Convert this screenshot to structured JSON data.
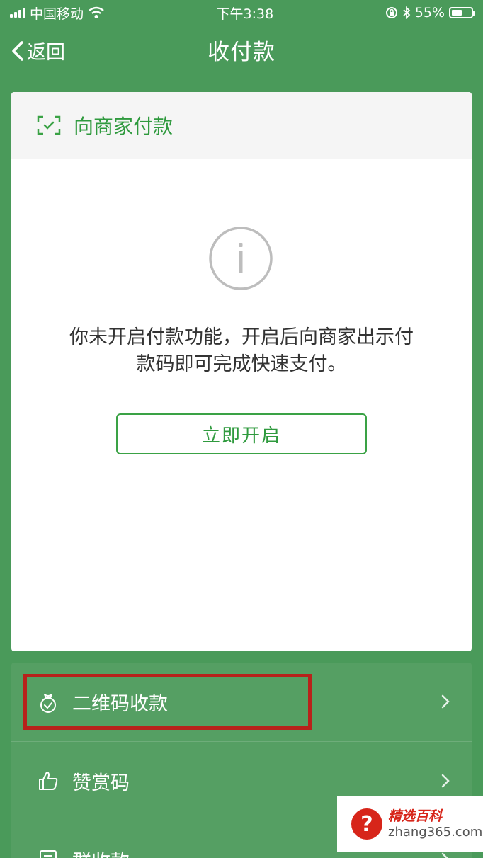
{
  "status_bar": {
    "carrier": "中国移动",
    "time": "下午3:38",
    "battery_percent": "55%",
    "battery_level": 0.55
  },
  "nav": {
    "back_label": "返回",
    "title": "收付款"
  },
  "pay_card": {
    "header_label": "向商家付款",
    "notice_line1": "你未开启付款功能，开启后向商家出示付",
    "notice_line2": "款码即可完成快速支付。",
    "enable_button": "立即开启"
  },
  "menu": {
    "items": [
      {
        "label": "二维码收款",
        "icon": "money-bag-icon"
      },
      {
        "label": "赞赏码",
        "icon": "thumbs-up-icon"
      },
      {
        "label": "群收款",
        "icon": "list-icon"
      }
    ]
  },
  "watermark": {
    "title": "精选百科",
    "url": "zhang365.com"
  },
  "colors": {
    "background": "#4a9a5a",
    "accent_green": "#2f9a3e",
    "highlight_red": "#b8221b"
  }
}
